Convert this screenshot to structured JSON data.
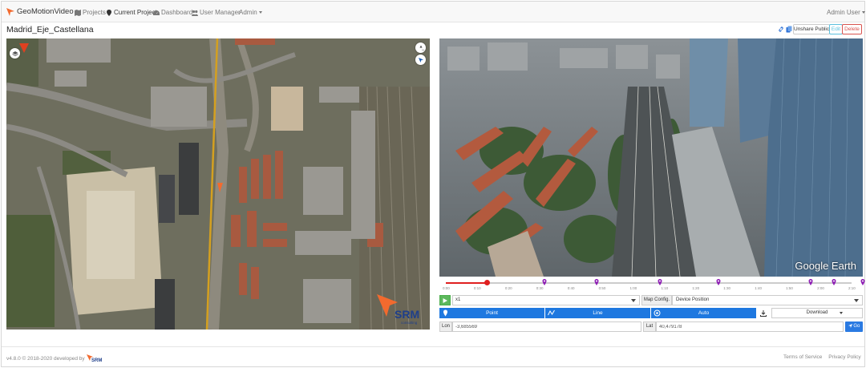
{
  "navbar": {
    "brand": "GeoMotionVideo",
    "links": [
      {
        "label": "Projects",
        "icon": "map-icon"
      },
      {
        "label": "Current Project",
        "icon": "map-marker-icon"
      },
      {
        "label": "Dashboard",
        "icon": "dashboard-icon"
      },
      {
        "label": "User Manager",
        "icon": "users-icon"
      },
      {
        "label": "Admin",
        "icon": "chevron-down-icon"
      }
    ],
    "user": "Admin User"
  },
  "project": {
    "title": "Madrid_Eje_Castellana",
    "actions": {
      "unshare": "Unshare Public",
      "edit": "Edit",
      "delete": "Delete"
    }
  },
  "colors": {
    "accent": "#1e78e0",
    "play": "#5cb85c",
    "progress": "#e02020",
    "marker": "#8e1fb4",
    "danger": "#d9534f",
    "info": "#5bc0de"
  },
  "earth": {
    "brand": "Google Earth"
  },
  "timeline": {
    "progress": 0.1,
    "labels": [
      "0:00",
      "0:10",
      "0:20",
      "0:30",
      "0:40",
      "0:50",
      "1:00",
      "1:10",
      "1:20",
      "1:30",
      "1:40",
      "1:50",
      "2:00",
      "2:10"
    ]
  },
  "controls": {
    "speed": "x1",
    "map_config_label": "Map Config.",
    "device_position": "Device Position",
    "modes": {
      "point": "Point",
      "line": "Line",
      "auto": "Auto"
    },
    "download": "Download",
    "lon_label": "Lon",
    "lon_value": "-3,685569",
    "lat_label": "Lat",
    "lat_value": "40,479178",
    "go": "Go"
  },
  "footer": {
    "copyright": "v4.8.0 © 2018-2020 developed by",
    "terms": "Terms of Service",
    "privacy": "Privacy Policy"
  }
}
